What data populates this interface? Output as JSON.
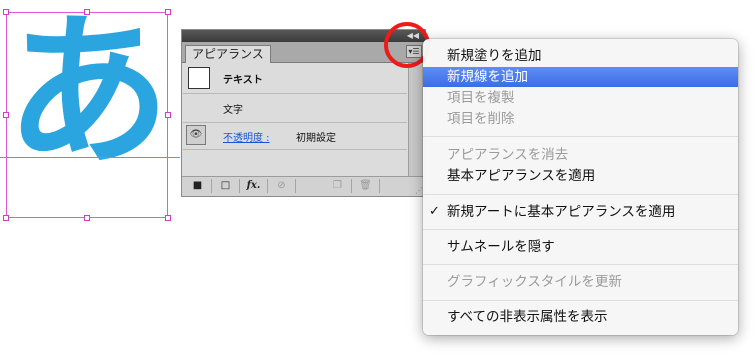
{
  "canvas": {
    "glyph": "あ",
    "glyph_color": "#2aa5df",
    "selection_color": "#e05ad6"
  },
  "appearance_panel": {
    "collapse_icon": "double-chevron-icon",
    "tab_label": "アピアランス",
    "menu_button_icon": "panel-menu-icon",
    "rows": [
      {
        "label": "テキスト"
      },
      {
        "label": "文字"
      },
      {
        "label": "不透明度 :",
        "value": "初期設定"
      }
    ],
    "bottom_buttons": [
      "new-fill-icon",
      "new-stroke-icon",
      "fx-icon",
      "clear-icon",
      "duplicate-icon",
      "trash-icon"
    ],
    "fx_label": "fx."
  },
  "context_menu": {
    "items": [
      {
        "label": "新規塗りを追加",
        "state": "normal"
      },
      {
        "label": "新規線を追加",
        "state": "selected"
      },
      {
        "label": "項目を複製",
        "state": "disabled"
      },
      {
        "label": "項目を削除",
        "state": "disabled"
      },
      {
        "label": "アピアランスを消去",
        "state": "disabled"
      },
      {
        "label": "基本アピアランスを適用",
        "state": "normal"
      },
      {
        "label": "新規アートに基本アピアランスを適用",
        "state": "checked"
      },
      {
        "label": "サムネールを隠す",
        "state": "normal"
      },
      {
        "label": "グラフィックスタイルを更新",
        "state": "disabled"
      },
      {
        "label": "すべての非表示属性を表示",
        "state": "normal"
      }
    ],
    "check_mark": "✓",
    "highlight_color": "#3a6ee6"
  },
  "annotation": {
    "circle_color": "#ee1b1b"
  }
}
